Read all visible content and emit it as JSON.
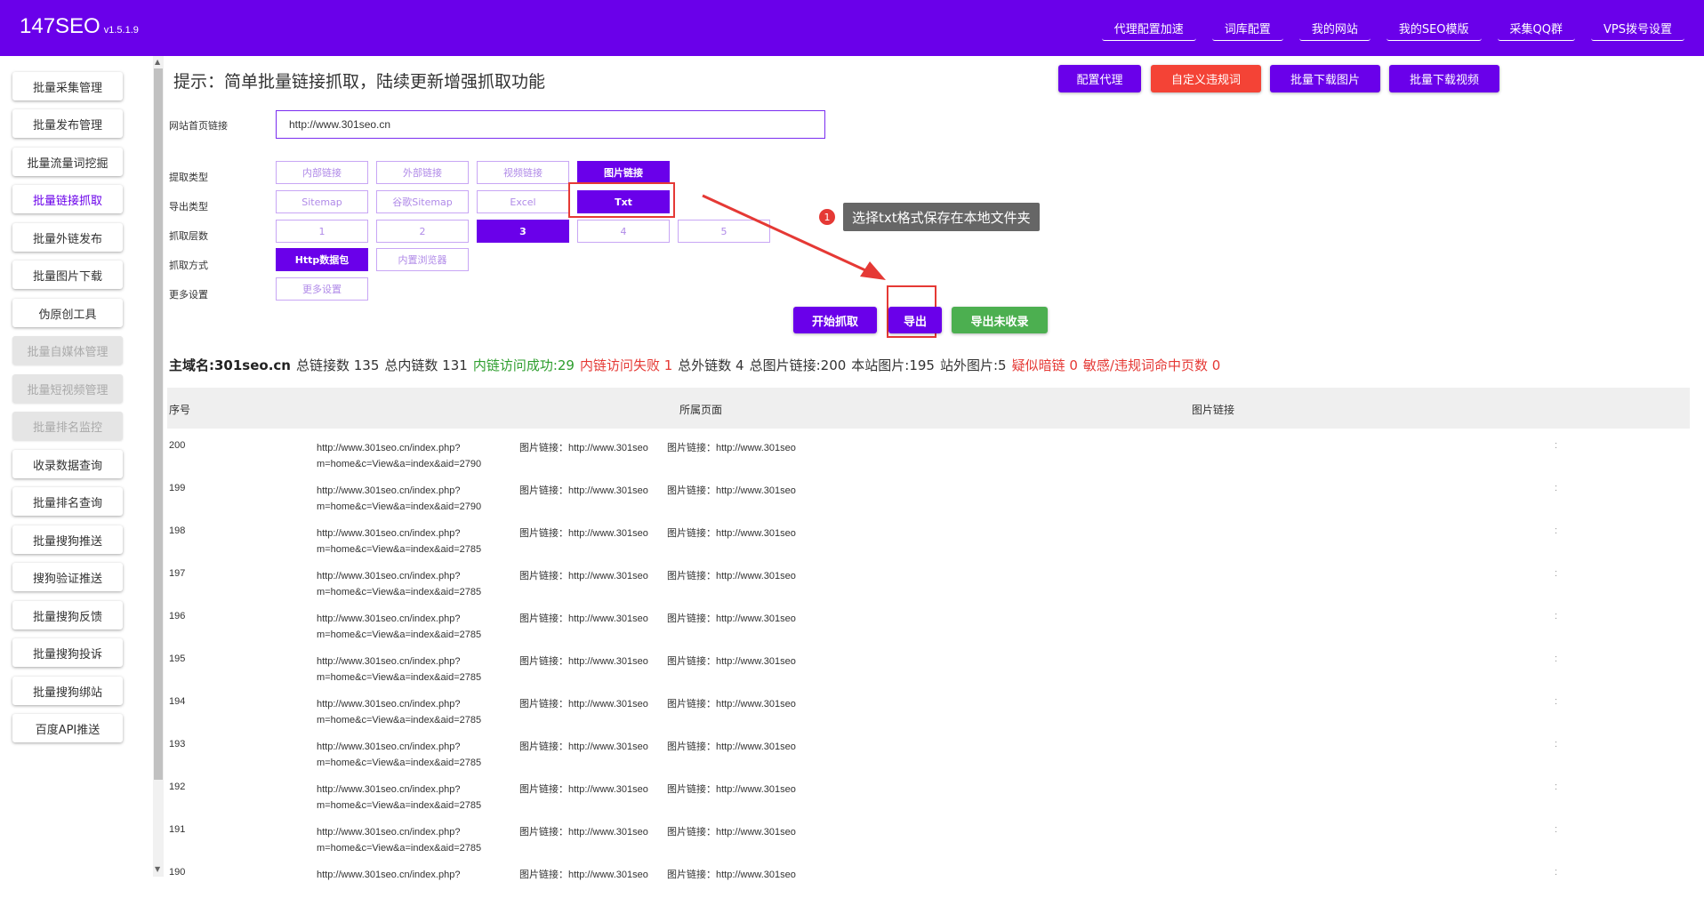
{
  "brand": {
    "name": "147SEO",
    "version": "v1.5.1.9"
  },
  "topnav": [
    "代理配置加速",
    "词库配置",
    "我的网站",
    "我的SEO模版",
    "采集QQ群",
    "VPS拨号设置"
  ],
  "sidebar": [
    {
      "label": "批量采集管理",
      "state": "normal"
    },
    {
      "label": "批量发布管理",
      "state": "normal"
    },
    {
      "label": "批量流量词挖掘",
      "state": "normal"
    },
    {
      "label": "批量链接抓取",
      "state": "active"
    },
    {
      "label": "批量外链发布",
      "state": "normal"
    },
    {
      "label": "批量图片下载",
      "state": "normal"
    },
    {
      "label": "伪原创工具",
      "state": "normal"
    },
    {
      "label": "批量自媒体管理",
      "state": "disabled"
    },
    {
      "label": "批量短视频管理",
      "state": "disabled"
    },
    {
      "label": "批量排名监控",
      "state": "disabled"
    },
    {
      "label": "收录数据查询",
      "state": "normal"
    },
    {
      "label": "批量排名查询",
      "state": "normal"
    },
    {
      "label": "批量搜狗推送",
      "state": "normal"
    },
    {
      "label": "搜狗验证推送",
      "state": "normal"
    },
    {
      "label": "批量搜狗反馈",
      "state": "normal"
    },
    {
      "label": "批量搜狗投诉",
      "state": "normal"
    },
    {
      "label": "批量搜狗绑站",
      "state": "normal"
    },
    {
      "label": "百度API推送",
      "state": "normal"
    }
  ],
  "tip": "提示：简单批量链接抓取，陆续更新增强抓取功能",
  "top_buttons": [
    {
      "label": "配置代理",
      "color": "#6a00ea"
    },
    {
      "label": "自定义违规词",
      "color": "#f44336"
    },
    {
      "label": "批量下载图片",
      "color": "#6a00ea"
    },
    {
      "label": "批量下载视频",
      "color": "#6a00ea"
    }
  ],
  "form": {
    "url_label": "网站首页链接",
    "url_value": "http://www.301seo.cn",
    "extract_type_label": "提取类型",
    "extract_types": [
      "内部链接",
      "外部链接",
      "视频链接",
      "图片链接"
    ],
    "extract_selected": "图片链接",
    "export_type_label": "导出类型",
    "export_types": [
      "Sitemap",
      "谷歌Sitemap",
      "Excel",
      "Txt"
    ],
    "export_selected": "Txt",
    "depth_label": "抓取层数",
    "depths": [
      "1",
      "2",
      "3",
      "4",
      "5"
    ],
    "depth_selected": "3",
    "method_label": "抓取方式",
    "methods": [
      "Http数据包",
      "内置浏览器"
    ],
    "method_selected": "Http数据包",
    "more_label": "更多设置",
    "more_button": "更多设置"
  },
  "annotation": {
    "number": "1",
    "text": "选择txt格式保存在本地文件夹"
  },
  "actions": [
    {
      "label": "开始抓取",
      "color": "#6a00ea"
    },
    {
      "label": "导出",
      "color": "#6a00ea"
    },
    {
      "label": "导出未收录",
      "color": "#4caf50"
    }
  ],
  "stats": [
    {
      "text": "主域名:301seo.cn",
      "color": "#222",
      "bold": true
    },
    {
      "text": "总链接数 135",
      "color": "#333"
    },
    {
      "text": "总内链数 131",
      "color": "#333"
    },
    {
      "text": "内链访问成功:29",
      "color": "#2e9e2e"
    },
    {
      "text": "内链访问失败 1",
      "color": "#e53935"
    },
    {
      "text": "总外链数 4",
      "color": "#333"
    },
    {
      "text": "总图片链接:200",
      "color": "#333"
    },
    {
      "text": "本站图片:195",
      "color": "#333"
    },
    {
      "text": "站外图片:5",
      "color": "#333"
    },
    {
      "text": "疑似暗链 0",
      "color": "#e53935"
    },
    {
      "text": "敏感/违规词命中页数 0",
      "color": "#e53935"
    }
  ],
  "table": {
    "headers": [
      "序号",
      "所属页面",
      "图片链接"
    ],
    "img_prefix": "图片链接：http://www.301seo",
    "colon": ":",
    "rows": [
      {
        "no": "200",
        "page1": "http://www.301seo.cn/index.php?",
        "page2": "m=home&c=View&a=index&aid=2790"
      },
      {
        "no": "199",
        "page1": "http://www.301seo.cn/index.php?",
        "page2": "m=home&c=View&a=index&aid=2790"
      },
      {
        "no": "198",
        "page1": "http://www.301seo.cn/index.php?",
        "page2": "m=home&c=View&a=index&aid=2785"
      },
      {
        "no": "197",
        "page1": "http://www.301seo.cn/index.php?",
        "page2": "m=home&c=View&a=index&aid=2785"
      },
      {
        "no": "196",
        "page1": "http://www.301seo.cn/index.php?",
        "page2": "m=home&c=View&a=index&aid=2785"
      },
      {
        "no": "195",
        "page1": "http://www.301seo.cn/index.php?",
        "page2": "m=home&c=View&a=index&aid=2785"
      },
      {
        "no": "194",
        "page1": "http://www.301seo.cn/index.php?",
        "page2": "m=home&c=View&a=index&aid=2785"
      },
      {
        "no": "193",
        "page1": "http://www.301seo.cn/index.php?",
        "page2": "m=home&c=View&a=index&aid=2785"
      },
      {
        "no": "192",
        "page1": "http://www.301seo.cn/index.php?",
        "page2": "m=home&c=View&a=index&aid=2785"
      },
      {
        "no": "191",
        "page1": "http://www.301seo.cn/index.php?",
        "page2": "m=home&c=View&a=index&aid=2785"
      },
      {
        "no": "190",
        "page1": "http://www.301seo.cn/index.php?",
        "page2": ""
      }
    ]
  }
}
